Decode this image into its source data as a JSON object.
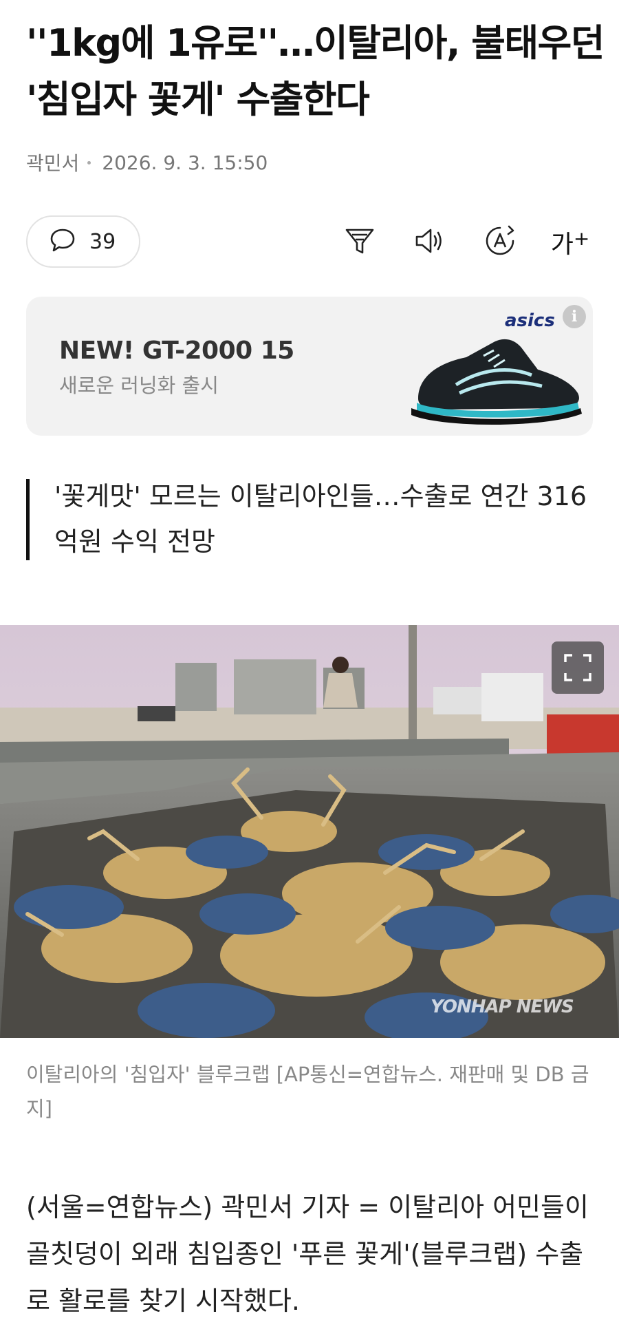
{
  "article": {
    "headline": "''1kg에 1유로''…이탈리아, 불태우던 '침입자 꽃게' 수출한다",
    "author": "곽민서",
    "datetime": "2026. 9. 3. 15:50"
  },
  "toolbar": {
    "comment_count": "39",
    "font_size_label": "가",
    "font_size_sup": "+"
  },
  "ad": {
    "title": "NEW! GT-2000 15",
    "subtitle": "새로운 러닝화 출시",
    "brand": "asics",
    "info_label": "i"
  },
  "summary": "'꽃게맛' 모르는 이탈리아인들…수출로 연간 316억원 수익 전망",
  "photo": {
    "watermark": "YONHAP NEWS",
    "caption": "이탈리아의 '침입자' 블루크랩 [AP통신=연합뉴스. 재판매 및 DB 금지]"
  },
  "body": {
    "paragraph_1": "(서울=연합뉴스) 곽민서 기자 = 이탈리아 어민들이 골칫덩이 외래 침입종인 '푸른 꽃게'(블루크랩) 수출로 활로를 찾기 시작했다."
  },
  "colors": {
    "text": "#111111",
    "muted": "#777777",
    "ad_background": "#f2f2f2",
    "brand_blue": "#1c2f7a"
  }
}
